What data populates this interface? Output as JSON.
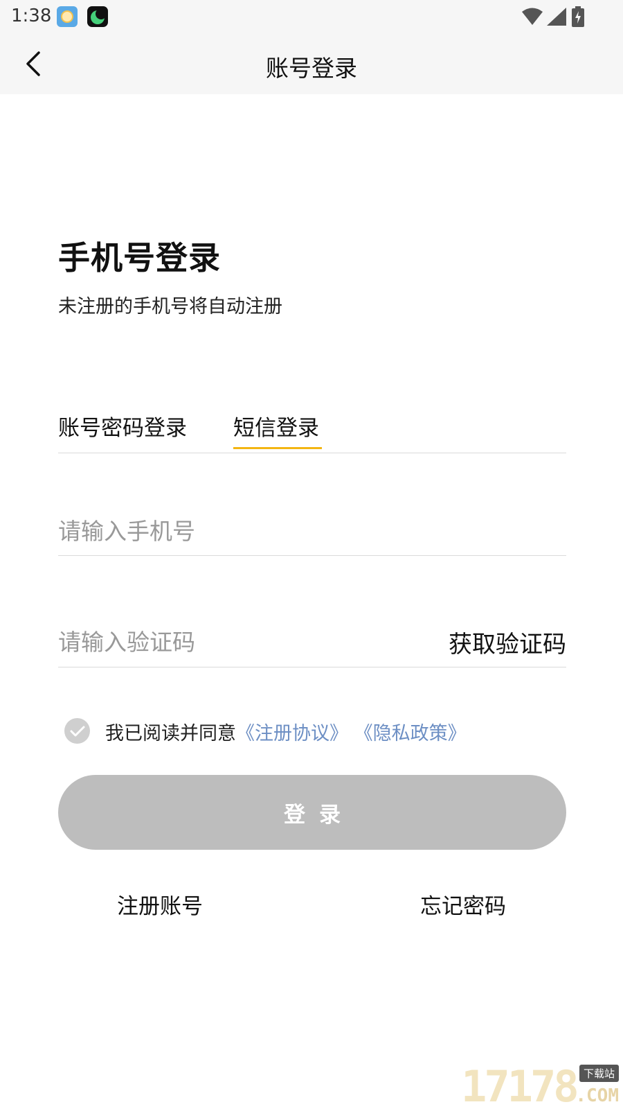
{
  "status_bar": {
    "time": "1:38"
  },
  "nav": {
    "title": "账号登录"
  },
  "page": {
    "heading": "手机号登录",
    "subheading": "未注册的手机号将自动注册"
  },
  "tabs": [
    {
      "label": "账号密码登录",
      "active": false
    },
    {
      "label": "短信登录",
      "active": true
    }
  ],
  "form": {
    "phone_placeholder": "请输入手机号",
    "phone_value": "",
    "code_placeholder": "请输入验证码",
    "code_value": "",
    "get_code_label": "获取验证码"
  },
  "agreement": {
    "text": "我已阅读并同意",
    "link_terms": "《注册协议》",
    "link_privacy": "《隐私政策》",
    "checked": false
  },
  "login_button": {
    "label": "登录"
  },
  "footer_links": {
    "register": "注册账号",
    "forgot": "忘记密码"
  },
  "watermark": {
    "number": "17178",
    "badge": "下载站",
    "suffix": ".COM"
  },
  "colors": {
    "tab_indicator": "#f3b512",
    "link": "#6d8fc4",
    "button_disabled": "#bdbdbd"
  }
}
